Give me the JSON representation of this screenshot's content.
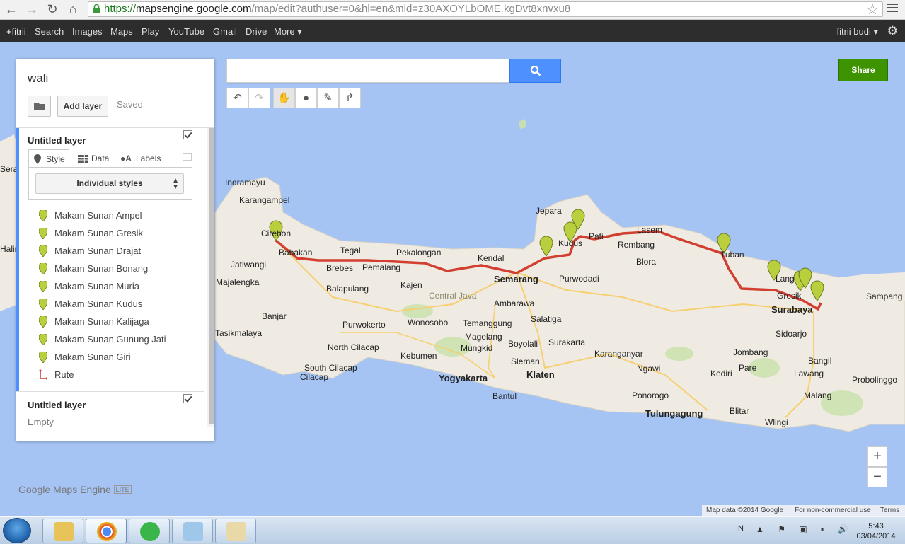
{
  "browser": {
    "url_scheme": "https://",
    "url_host": "mapsengine.google.com",
    "url_path": "/map/edit?authuser=0&hl=en&mid=z30AXOYLbOME.kgDvt8xnvxu8"
  },
  "google_bar": {
    "links": [
      "+fitrii",
      "Search",
      "Images",
      "Maps",
      "Play",
      "YouTube",
      "Gmail",
      "Drive",
      "More ▾"
    ],
    "user": "fitrii budi ▾"
  },
  "panel": {
    "title": "wali",
    "add_layer_label": "Add layer",
    "saved_label": "Saved",
    "layer1": {
      "title": "Untitled layer",
      "tabs": [
        "Style",
        "Data",
        "Labels"
      ],
      "style_select": "Individual styles",
      "features": [
        {
          "name": "Makam Sunan Ampel",
          "icon": "pin-icon"
        },
        {
          "name": "Makam Sunan Gresik",
          "icon": "pin-icon"
        },
        {
          "name": "Makam Sunan Drajat",
          "icon": "pin-icon"
        },
        {
          "name": "Makam Sunan Bonang",
          "icon": "pin-icon"
        },
        {
          "name": "Makam Sunan Muria",
          "icon": "pin-icon"
        },
        {
          "name": "Makam Sunan Kudus",
          "icon": "pin-icon"
        },
        {
          "name": "Makam Sunan Kalijaga",
          "icon": "pin-icon"
        },
        {
          "name": "Makam Sunan Gunung Jati",
          "icon": "pin-icon"
        },
        {
          "name": "Makam Sunan Giri",
          "icon": "pin-icon"
        },
        {
          "name": "Rute",
          "icon": "route-icon"
        }
      ]
    },
    "layer2": {
      "title": "Untitled layer",
      "empty_label": "Empty"
    }
  },
  "map": {
    "share_label": "Share",
    "zoom_in": "+",
    "zoom_out": "−",
    "brand": "Google Maps Engine",
    "brand_badge": "LITE",
    "footer": {
      "data": "Map data ©2014 Google",
      "noncommercial": "For non-commercial use",
      "terms": "Terms"
    },
    "places": [
      "Indramayu",
      "Karangampel",
      "Cirebon",
      "Jatiwangi",
      "Majalengka",
      "Babakan",
      "Tegal",
      "Brebes",
      "Pemalang",
      "Pekalongan",
      "Kendal",
      "Kajen",
      "Balapulang",
      "Semarang",
      "Central Java",
      "Ambarawa",
      "Salatiga",
      "Purwodadi",
      "Jepara",
      "Kudus",
      "Pati",
      "Lasem",
      "Rembang",
      "Blora",
      "Tuban",
      "Gresik",
      "Sampang",
      "Surabaya",
      "Sidoarjo",
      "Bangil",
      "Purwokerto",
      "Wonosobo",
      "Temanggung",
      "Magelang",
      "Mungkid",
      "Boyolali",
      "Surakarta",
      "Karanganyar",
      "Ngawi",
      "Banjar",
      "Tasikmalaya",
      "North Cilacap",
      "South Cilacap",
      "Cilacap",
      "Kebumen",
      "Yogyakarta",
      "Sleman",
      "Klaten",
      "Bantul",
      "Jombang",
      "Pare",
      "Kediri",
      "Ponorogo",
      "Tulungagung",
      "Blitar",
      "Wlingi",
      "Lawang",
      "Malang",
      "Probolinggo",
      "Serang",
      "Halimun",
      "Lang"
    ]
  },
  "taskbar": {
    "lang": "IN",
    "time": "5:43",
    "date": "03/04/2014"
  }
}
